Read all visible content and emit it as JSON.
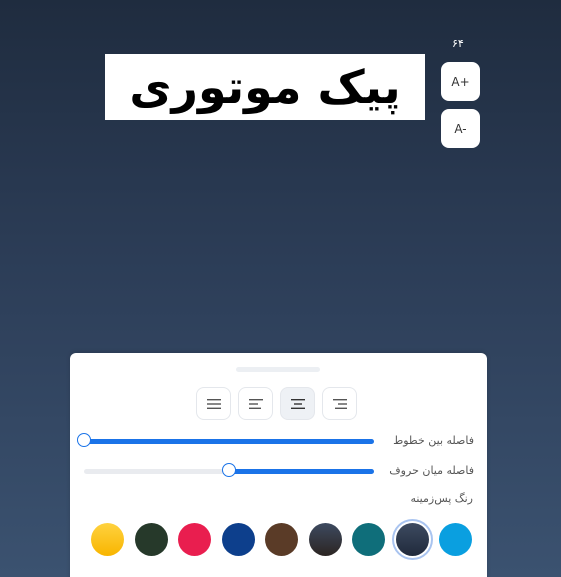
{
  "font_size": {
    "value": "۶۴",
    "increase_label": "A+",
    "decrease_label": "A-"
  },
  "sample": {
    "text": "پیک موتوری"
  },
  "panel": {
    "alignment": {
      "options": [
        "right",
        "center",
        "left",
        "justify"
      ],
      "selected": "center"
    },
    "line_spacing": {
      "label": "فاصله بین خطوط",
      "value": 0
    },
    "letter_spacing": {
      "label": "فاصله میان حروف",
      "value": 0.5
    },
    "background_color": {
      "label": "رنگ پس‌زمینه",
      "selected_index": 1,
      "colors": [
        "#0a9fe0",
        "#202a3c",
        "#0f6e7a",
        "#2c2522",
        "#5a3b27",
        "#0d3f8c",
        "#e91e4f",
        "#26392a",
        "#f8b500"
      ]
    },
    "accent": "#1a73e8"
  }
}
